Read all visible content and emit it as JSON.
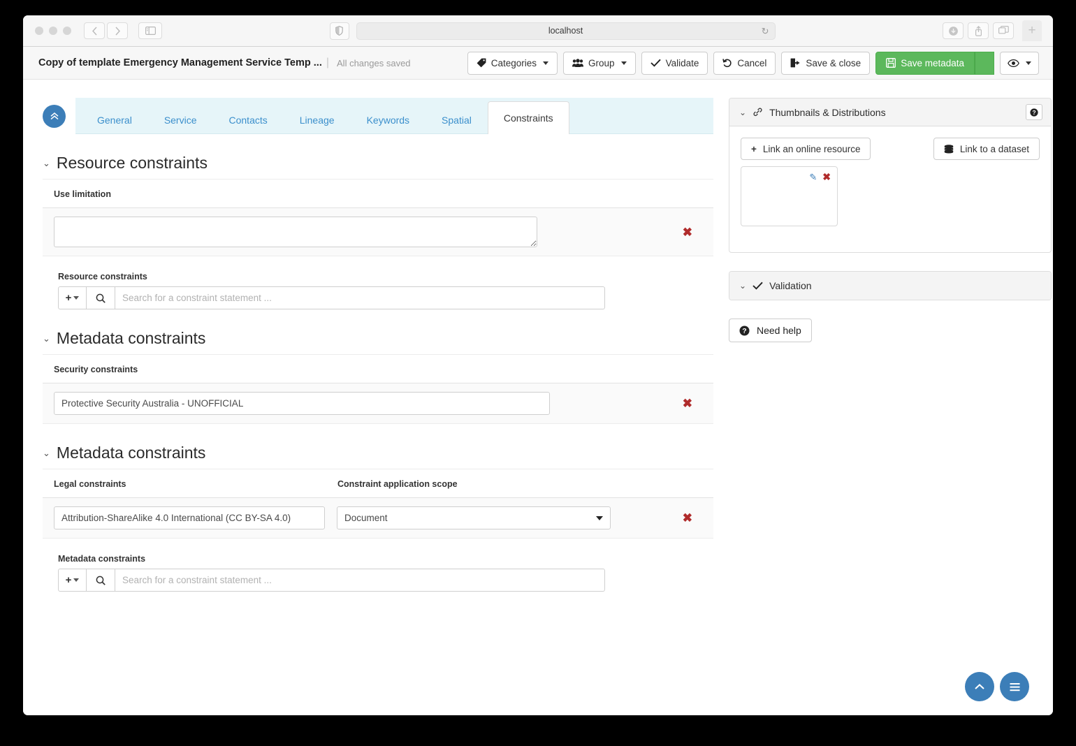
{
  "browser": {
    "url": "localhost",
    "nav_back_icon": "chevron-left-icon",
    "nav_forward_icon": "chevron-right-icon",
    "sidebar_icon": "sidebar-toggle-icon",
    "shield_icon": "shield-icon",
    "reload_icon": "reload-icon",
    "download_icon": "download-icon",
    "share_icon": "share-icon",
    "tabs_icon": "tab-overview-icon",
    "new_tab_icon": "plus-icon"
  },
  "header": {
    "doc_title": "Copy of template Emergency Management Service Temp ...",
    "separator": "|",
    "save_status": "All changes saved"
  },
  "toolbar": {
    "categories": "Categories",
    "group": "Group",
    "validate": "Validate",
    "cancel": "Cancel",
    "save_close": "Save & close",
    "save_metadata": "Save metadata",
    "view_mode_icon": "eye-icon",
    "accent_green": "#5cb85c"
  },
  "tabs": {
    "collapse_icon": "double-chevron-up-icon",
    "items": [
      {
        "label": "General",
        "active": false
      },
      {
        "label": "Service",
        "active": false
      },
      {
        "label": "Contacts",
        "active": false
      },
      {
        "label": "Lineage",
        "active": false
      },
      {
        "label": "Keywords",
        "active": false
      },
      {
        "label": "Spatial",
        "active": false
      },
      {
        "label": "Constraints",
        "active": true
      }
    ],
    "accent_blue": "#3b8fcc",
    "strip_bg": "#e6f5f9"
  },
  "resource_constraints": {
    "legend": "Resource constraints",
    "use_limitation_label": "Use limitation",
    "use_limitation_value": "",
    "sub_label": "Resource constraints",
    "search_placeholder": "Search for a constraint statement ...",
    "add_icon": "plus-icon",
    "search_icon": "search-icon",
    "delete_icon": "delete-x-icon"
  },
  "metadata_constraints_security": {
    "legend": "Metadata constraints",
    "security_label": "Security constraints",
    "security_value": "Protective Security Australia - UNOFFICIAL",
    "delete_icon": "delete-x-icon"
  },
  "metadata_constraints_legal": {
    "legend": "Metadata constraints",
    "legal_label": "Legal constraints",
    "legal_value": "Attribution-ShareAlike 4.0 International (CC BY-SA 4.0)",
    "scope_label": "Constraint application scope",
    "scope_value": "Document",
    "scope_options": [
      "Document"
    ],
    "sub_label": "Metadata constraints",
    "search_placeholder": "Search for a constraint statement ...",
    "add_icon": "plus-icon",
    "search_icon": "search-icon",
    "delete_icon": "delete-x-icon"
  },
  "thumbnails_panel": {
    "title": "Thumbnails & Distributions",
    "panel_icon": "link-icon",
    "chevron": "chevron-down-icon",
    "help_icon": "question-mark-icon",
    "link_online_resource": "Link an online resource",
    "link_dataset": "Link to a dataset",
    "link_online_icon": "plus-icon",
    "link_dataset_icon": "database-icon",
    "thumb_edit_icon": "pencil-icon",
    "thumb_delete_icon": "delete-x-icon"
  },
  "validation_panel": {
    "title": "Validation",
    "panel_icon": "check-icon",
    "chevron": "chevron-down-icon"
  },
  "need_help": {
    "label": "Need help",
    "icon": "question-mark-circle-icon"
  },
  "fabs": {
    "scroll_top_icon": "chevron-up-icon",
    "menu_icon": "hamburger-menu-icon",
    "color": "#3c7eb8"
  }
}
